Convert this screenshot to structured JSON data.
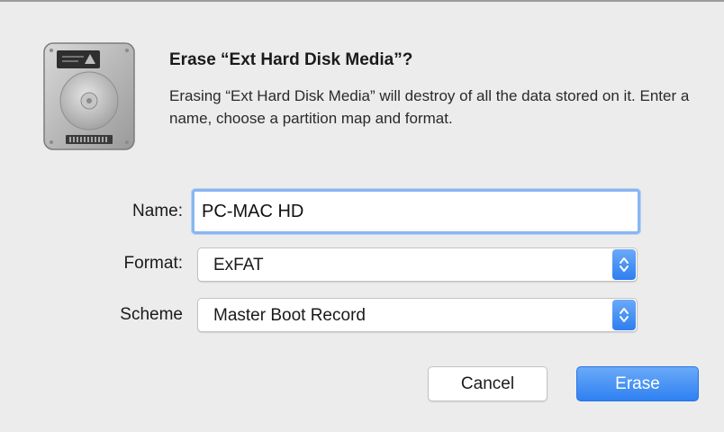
{
  "dialog": {
    "title": "Erase “Ext Hard Disk Media”?",
    "message": "Erasing “Ext Hard Disk Media” will destroy of all the data stored on it. Enter a name, choose a partition map and format.",
    "icon": "hard-disk-icon"
  },
  "form": {
    "name_label": "Name:",
    "name_value": "PC-MAC HD",
    "format_label": "Format:",
    "format_value": "ExFAT",
    "scheme_label": "Scheme",
    "scheme_value": "Master Boot Record",
    "stepper_icon": "up-down-chevron-icon"
  },
  "buttons": {
    "cancel_label": "Cancel",
    "erase_label": "Erase"
  },
  "colors": {
    "accent": "#2f80f2",
    "focus_ring": "#8ab6f0",
    "background": "#ececec"
  }
}
